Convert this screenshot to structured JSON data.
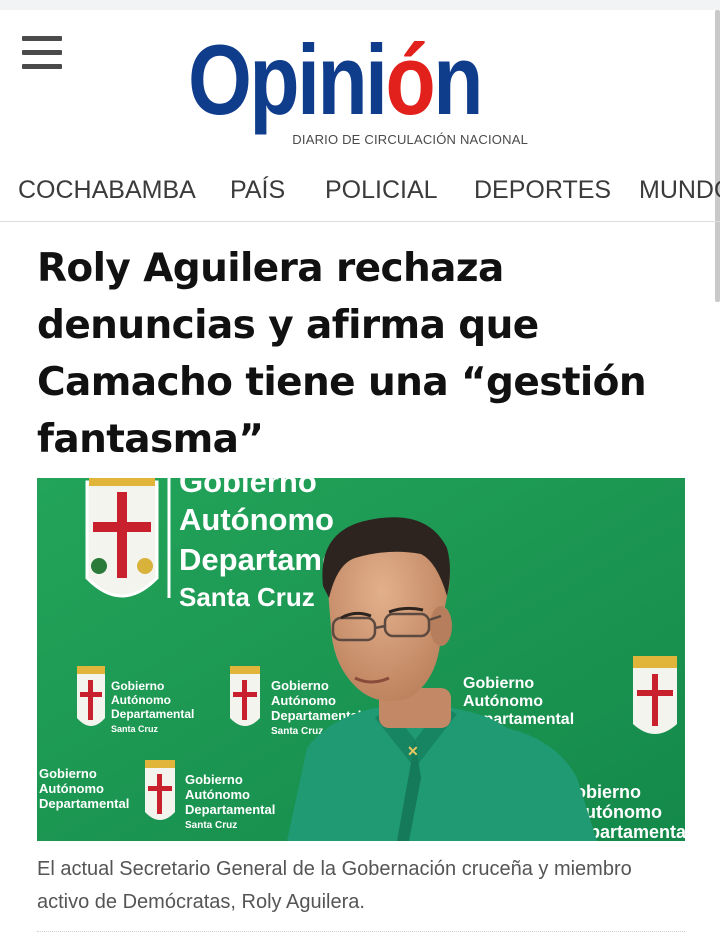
{
  "site": {
    "logo": {
      "text_main": "Opini",
      "text_accent": "ó",
      "text_end": "n",
      "tagline": "DIARIO DE CIRCULACIÓN NACIONAL"
    },
    "menu_icon": "hamburger-menu-icon"
  },
  "nav": {
    "items": [
      {
        "label": "COCHABAMBA"
      },
      {
        "label": "PAÍS"
      },
      {
        "label": "POLICIAL"
      },
      {
        "label": "DEPORTES"
      },
      {
        "label": "MUNDO"
      }
    ]
  },
  "article": {
    "headline": "Roly Aguilera rechaza denuncias y afirma que Camacho tiene una “gestión fantasma”",
    "image": {
      "backdrop_text_large": [
        "Gobierno",
        "Autónomo",
        "Departame",
        "Santa Cruz"
      ],
      "backdrop_text_small": [
        "Gobierno",
        "Autónomo",
        "Departamental",
        "Santa Cruz"
      ],
      "backdrop_text_edge": [
        "obierno",
        "utónomo",
        "partamental"
      ]
    },
    "caption": "El actual Secretario General de la Gobernación cruceña y miembro activo de Demócratas, Roly Aguilera."
  },
  "colors": {
    "brand_blue": "#0f3d8c",
    "brand_red": "#e3211c",
    "backdrop_green": "#1c9a55",
    "shirt_green": "#1f9a72"
  }
}
